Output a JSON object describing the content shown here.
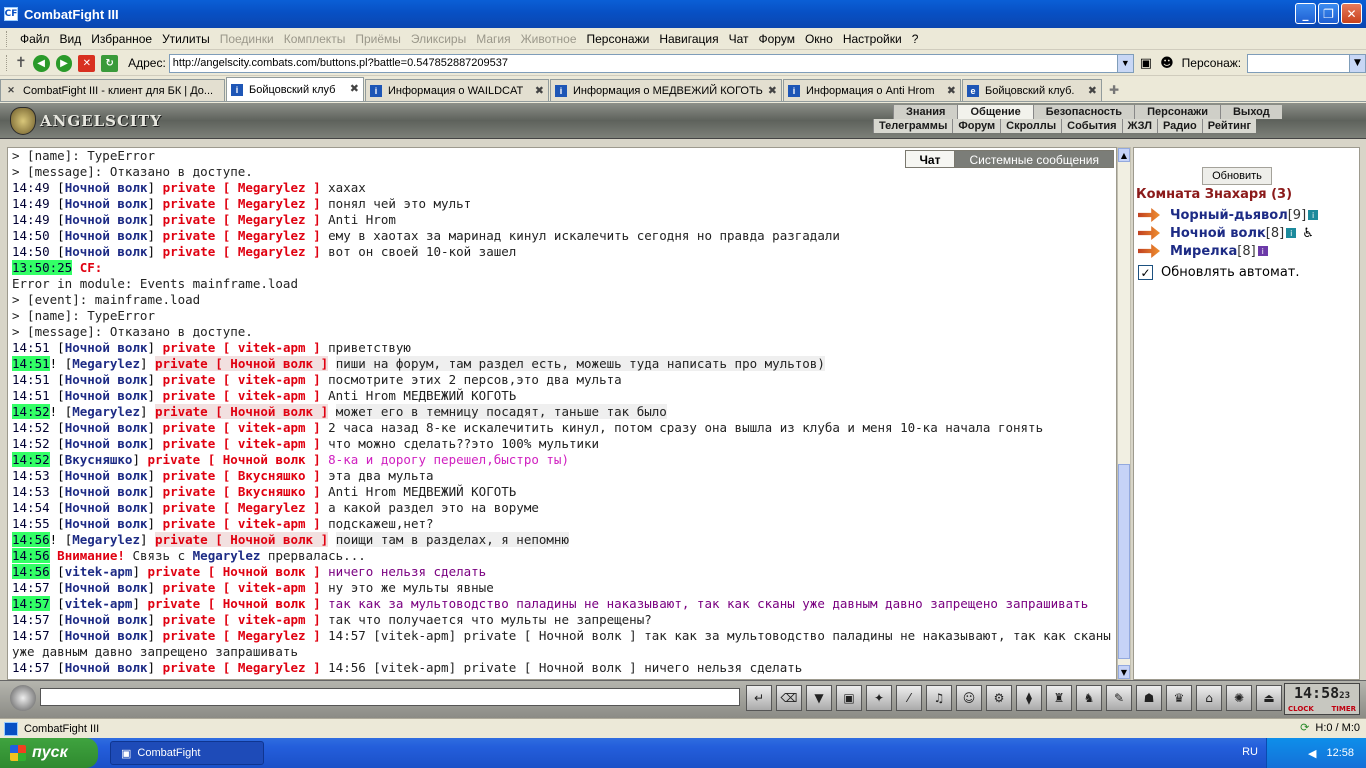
{
  "window": {
    "title": "CombatFight III"
  },
  "menu": [
    "Файл",
    "Вид",
    "Избранное",
    "Утилиты",
    "Поединки",
    "Комплекты",
    "Приёмы",
    "Эликсиры",
    "Магия",
    "Животное",
    "Персонажи",
    "Навигация",
    "Чат",
    "Форум",
    "Окно",
    "Настройки",
    "?"
  ],
  "menu_disabled": [
    4,
    5,
    6,
    7,
    8,
    9
  ],
  "address": {
    "label": "Адрес:",
    "url": "http://angelscity.combats.com/buttons.pl?battle=0.547852887209537",
    "persona_label": "Персонаж:"
  },
  "tabs": [
    {
      "label": "CombatFight III - клиент для БК | До...",
      "active": false
    },
    {
      "label": "Бойцовский клуб",
      "active": true
    },
    {
      "label": "Информация о WAILDCAT",
      "active": false
    },
    {
      "label": "Информация о МЕДВЕЖИЙ КОГОТЬ",
      "active": false
    },
    {
      "label": "Информация о Anti Hrom",
      "active": false
    },
    {
      "label": "Бойцовский клуб.",
      "active": false
    }
  ],
  "game": {
    "logo": "ANGELSCITY",
    "nav1": [
      "Знания",
      "Общение",
      "Безопасность",
      "Персонажи",
      "Выход"
    ],
    "nav1_active": 1,
    "nav2": [
      "Телеграммы",
      "Форум",
      "Скроллы",
      "События",
      "ЖЗЛ",
      "Радио",
      "Рейтинг"
    ],
    "chat_tabs": [
      "Чат",
      "Системные сообщения"
    ]
  },
  "chat": [
    {
      "raw": "> [name]: TypeError"
    },
    {
      "raw": "> [message]: Отказано в доступе."
    },
    {
      "t": "14:49",
      "n": "Ночной волк",
      "p": "Megarylez",
      "m": "хахах"
    },
    {
      "t": "14:49",
      "n": "Ночной волк",
      "p": "Megarylez",
      "m": "понял чей это мульт"
    },
    {
      "t": "14:49",
      "n": "Ночной волк",
      "p": "Megarylez",
      "m": "Anti Hrom"
    },
    {
      "t": "14:50",
      "n": "Ночной волк",
      "p": "Megarylez",
      "m": "ему в хаотах за маринад кинул искалечить сегодня но правда разгадали"
    },
    {
      "t": "14:50",
      "n": "Ночной волк",
      "p": "Megarylez",
      "m": "вот он своей 10-кой зашел"
    },
    {
      "cf": true,
      "t": "13:50:25",
      "label": "CF:"
    },
    {
      "raw": "Error in module: Events mainframe.load"
    },
    {
      "raw": "> [event]: mainframe.load"
    },
    {
      "raw": "> [name]: TypeError"
    },
    {
      "raw": "> [message]: Отказано в доступе."
    },
    {
      "t": "14:51",
      "n": "Ночной волк",
      "p": "vitek-apm",
      "m": "приветствую"
    },
    {
      "t": "14:51",
      "hl": true,
      "bang": true,
      "n": "Megarylez",
      "p": "Ночной волк",
      "m": "пиши на форум, там раздел есть, можешь туда написать про мультов)",
      "bg": true
    },
    {
      "t": "14:51",
      "n": "Ночной волк",
      "p": "vitek-apm",
      "m": "посмотрите этих 2 персов,это два мульта"
    },
    {
      "t": "14:51",
      "n": "Ночной волк",
      "p": "vitek-apm",
      "m": "Anti Hrom МЕДВЕЖИЙ КОГОТЬ"
    },
    {
      "t": "14:52",
      "hl": true,
      "bang": true,
      "n": "Megarylez",
      "p": "Ночной волк",
      "m": "может его в темницу посадят, таньше так было",
      "bg": true
    },
    {
      "t": "14:52",
      "n": "Ночной волк",
      "p": "vitek-apm",
      "m": "2 часа назад 8-ке искалечитить кинул, потом сразу она вышла из клуба и меня 10-ка начала гонять"
    },
    {
      "t": "14:52",
      "n": "Ночной волк",
      "p": "vitek-apm",
      "m": "что можно сделать??это 100% мультики"
    },
    {
      "t": "14:52",
      "hl": true,
      "n": "Вкусняшко",
      "p": "Ночной волк",
      "m": "8-ка и дорогу перешел,быстро ты)",
      "color": "pink"
    },
    {
      "t": "14:53",
      "n": "Ночной волк",
      "p": "Вкусняшко",
      "m": "эта два мульта"
    },
    {
      "t": "14:53",
      "n": "Ночной волк",
      "p": "Вкусняшко",
      "m": "Anti Hrom МЕДВЕЖИЙ КОГОТЬ"
    },
    {
      "t": "14:54",
      "n": "Ночной волк",
      "p": "Megarylez",
      "m": "а какой раздел это на воруме"
    },
    {
      "t": "14:55",
      "n": "Ночной волк",
      "p": "vitek-apm",
      "m": "подскажеш,нет?"
    },
    {
      "t": "14:56",
      "hl": true,
      "bang": true,
      "n": "Megarylez",
      "p": "Ночной волк",
      "m": "поищи там в разделах, я непомню",
      "bg": true
    },
    {
      "warn": true,
      "t": "14:56",
      "label": "Внимание!",
      "pre": "Связь с",
      "who": "Megarylez",
      "post": "прервалась..."
    },
    {
      "t": "14:56",
      "hl": true,
      "n": "vitek-apm",
      "p": "Ночной волк",
      "m": "ничего нельзя сделать",
      "color": "purp"
    },
    {
      "t": "14:57",
      "n": "Ночной волк",
      "p": "vitek-apm",
      "m": "ну это же мульты явные"
    },
    {
      "t": "14:57",
      "hl": true,
      "n": "vitek-apm",
      "p": "Ночной волк",
      "m": "так как за мультоводство паладины не наказывают, так как сканы уже давным давно запрещено запрашивать",
      "color": "purp"
    },
    {
      "t": "14:57",
      "n": "Ночной волк",
      "p": "vitek-apm",
      "m": "так что получается что мульты не запрещены?"
    },
    {
      "t": "14:57",
      "n": "Ночной волк",
      "p": "Megarylez",
      "m": "14:57 [vitek-apm] private [ Ночной волк ] так как за мультоводство паладины не наказывают, так как сканы уже давным давно запрещено запрашивать",
      "wrap": true
    },
    {
      "t": "14:57",
      "n": "Ночной волк",
      "p": "Megarylez",
      "m": "14:56 [vitek-apm] private [ Ночной волк ] ничего нельзя сделать"
    }
  ],
  "private_word": "private",
  "sidebar": {
    "refresh": "Обновить",
    "room": "Комната Знахаря (3)",
    "users": [
      {
        "name": "Чорный-дьявол",
        "level": "[9]",
        "badge": "i",
        "extra": false
      },
      {
        "name": "Ночной волк",
        "level": "[8]",
        "badge": "i",
        "extra": true
      },
      {
        "name": "Мирелка",
        "level": "[8]",
        "badge": "i",
        "extra": false
      }
    ],
    "auto": "Обновлять автомат."
  },
  "clock": {
    "time": "14:58",
    "sec": "23",
    "clock_label": "CLOCK",
    "timer_label": "TIMER"
  },
  "status": {
    "text": "CombatFight III",
    "hm": "H:0 / M:0"
  },
  "taskbar": {
    "start": "пуск",
    "task": "CombatFight",
    "lang": "RU",
    "time": "12:58"
  }
}
